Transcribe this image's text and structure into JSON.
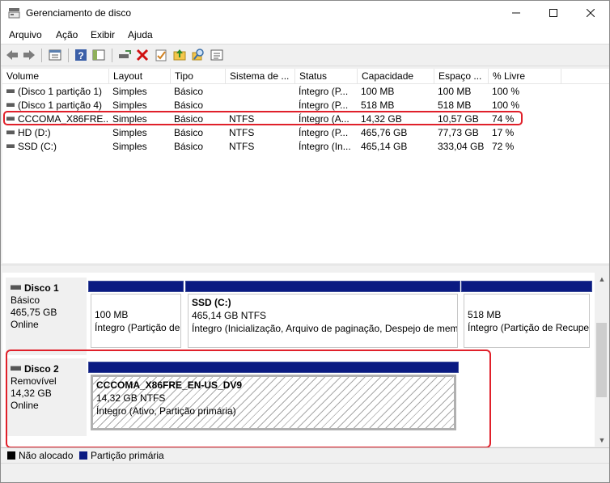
{
  "window": {
    "title": "Gerenciamento de disco"
  },
  "menu": [
    "Arquivo",
    "Ação",
    "Exibir",
    "Ajuda"
  ],
  "toolbar_icons": [
    "back-icon",
    "forward-icon",
    "properties-list-icon",
    "help-icon",
    "console-tree-icon",
    "connect-drive-icon",
    "delete-icon",
    "check-icon",
    "open-icon",
    "search-icon",
    "details-icon"
  ],
  "list": {
    "columns": [
      "Volume",
      "Layout",
      "Tipo",
      "Sistema de ...",
      "Status",
      "Capacidade",
      "Espaço ...",
      "% Livre"
    ],
    "rows": [
      [
        "(Disco 1 partição 1)",
        "Simples",
        "Básico",
        "",
        "Íntegro (P...",
        "100 MB",
        "100 MB",
        "100 %"
      ],
      [
        "(Disco 1 partição 4)",
        "Simples",
        "Básico",
        "",
        "Íntegro (P...",
        "518 MB",
        "518 MB",
        "100 %"
      ],
      [
        "CCCOMA_X86FRE...",
        "Simples",
        "Básico",
        "NTFS",
        "Íntegro (A...",
        "14,32 GB",
        "10,57 GB",
        "74 %"
      ],
      [
        "HD (D:)",
        "Simples",
        "Básico",
        "NTFS",
        "Íntegro (P...",
        "465,76 GB",
        "77,73 GB",
        "17 %"
      ],
      [
        "SSD (C:)",
        "Simples",
        "Básico",
        "NTFS",
        "Íntegro (In...",
        "465,14 GB",
        "333,04 GB",
        "72 %"
      ]
    ]
  },
  "disks": [
    {
      "name": "Disco 1",
      "type": "Básico",
      "size": "465,75 GB",
      "state": "Online",
      "partitions": [
        {
          "name": "",
          "size": "100 MB",
          "status": "Íntegro (Partição de"
        },
        {
          "name": "SSD  (C:)",
          "size": "465,14 GB NTFS",
          "status": "Íntegro (Inicialização, Arquivo de paginação, Despejo de mem"
        },
        {
          "name": "",
          "size": "518 MB",
          "status": "Íntegro (Partição de Recuper"
        }
      ]
    },
    {
      "name": "Disco 2",
      "type": "Removível",
      "size": "14,32 GB",
      "state": "Online",
      "partitions": [
        {
          "name": "CCCOMA_X86FRE_EN-US_DV9",
          "size": "14,32 GB NTFS",
          "status": "Íntegro (Ativo, Partição primária)"
        }
      ]
    }
  ],
  "legend": [
    {
      "label": "Não alocado",
      "color": "#000000"
    },
    {
      "label": "Partição primária",
      "color": "#0a1a82"
    }
  ],
  "colors": {
    "highlight": "#e0202a",
    "partition_bar": "#0a1a82"
  }
}
